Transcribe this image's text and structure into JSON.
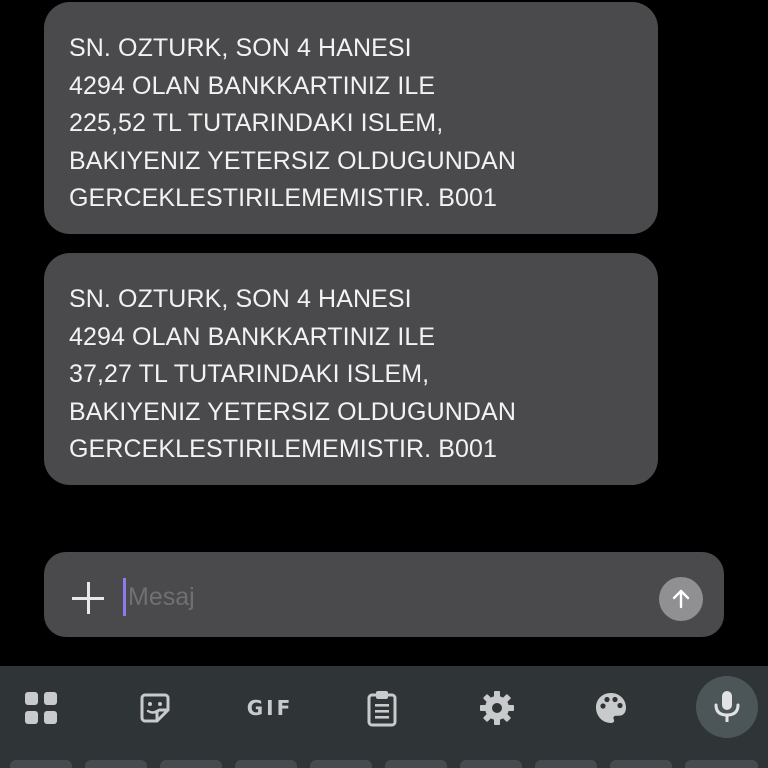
{
  "messages": [
    {
      "lines": [
        "SN. OZTURK, SON 4 HANESI",
        "4294 OLAN BANKKARTINIZ ILE",
        "225,52 TL TUTARINDAKI ISLEM,",
        "BAKIYENIZ YETERSIZ OLDUGUNDAN",
        "GERCEKLESTIRILEMEMISTIR. B001"
      ]
    },
    {
      "lines": [
        "SN. OZTURK, SON 4 HANESI",
        "4294 OLAN BANKKARTINIZ ILE",
        "37,27 TL TUTARINDAKI ISLEM,",
        "BAKIYENIZ YETERSIZ OLDUGUNDAN",
        "GERCEKLESTIRILEMEMISTIR. B001"
      ]
    }
  ],
  "composer": {
    "placeholder": "Mesaj",
    "value": "",
    "add_icon": "plus-icon",
    "send_icon": "arrow-up-icon"
  },
  "keyboard_toolbar": {
    "items": [
      {
        "icon": "apps-grid-icon"
      },
      {
        "icon": "sticker-icon"
      },
      {
        "label": "GIF"
      },
      {
        "icon": "clipboard-icon"
      },
      {
        "icon": "gear-icon"
      },
      {
        "icon": "palette-icon"
      },
      {
        "icon": "microphone-icon"
      }
    ]
  },
  "colors": {
    "background": "#000000",
    "bubble": "#4a4a4c",
    "text": "#f2f2f2",
    "caret": "#8a7cf0",
    "keyboard_bar": "#2f3436"
  }
}
